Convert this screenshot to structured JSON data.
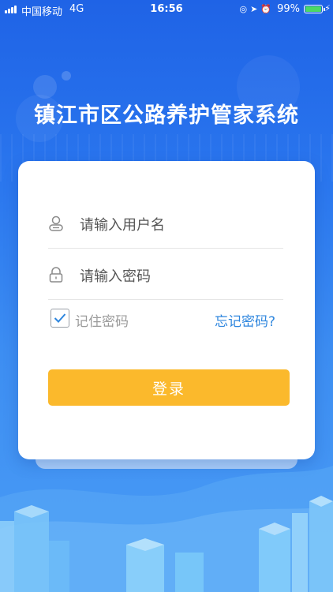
{
  "status_bar": {
    "carrier": "中国移动",
    "network": "4G",
    "time": "16:56",
    "battery": "99%",
    "battery_color": "#4cd964"
  },
  "app": {
    "title": "镇江市区公路养护管家系统"
  },
  "login": {
    "username_placeholder": "请输入用户名",
    "password_placeholder": "请输入密码",
    "remember_label": "记住密码",
    "remember_checked": true,
    "forgot_label": "忘记密码?",
    "submit_label": "登录"
  },
  "icons": {
    "user": "user-icon",
    "lock": "lock-icon",
    "check": "checkmark-icon"
  },
  "colors": {
    "accent_button": "#fbb92c",
    "link": "#2e86de",
    "background_top": "#1f63e6",
    "background_bottom": "#4a9cf5"
  }
}
